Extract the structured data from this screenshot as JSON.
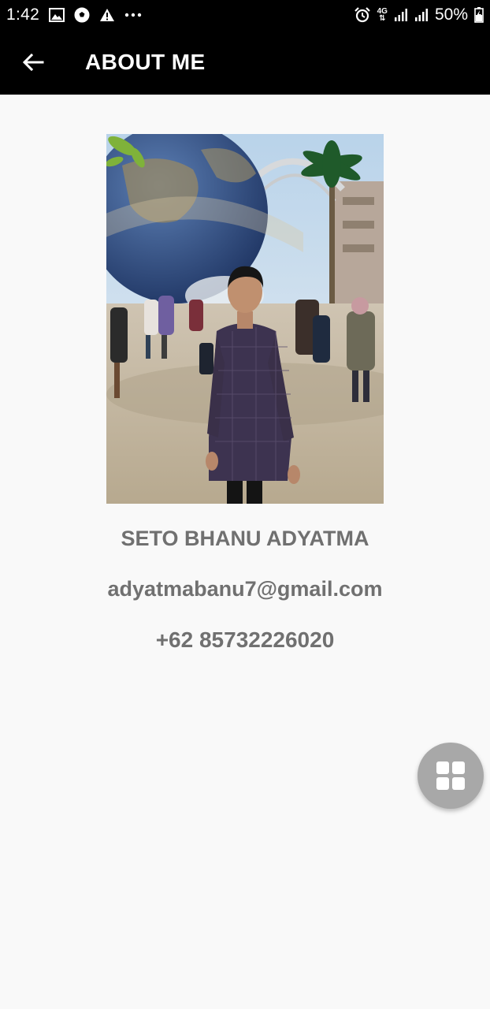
{
  "status_bar": {
    "time": "1:42",
    "network": "4G",
    "battery": "50%",
    "left_icons": [
      "image-icon",
      "soccer-ball-icon",
      "warning-icon",
      "more-dots-icon"
    ],
    "right_icons": [
      "alarm-icon",
      "signal-icon",
      "signal-icon",
      "battery-charging-icon"
    ]
  },
  "app_bar": {
    "title": "ABOUT ME",
    "back_icon": "arrow-left-icon"
  },
  "profile": {
    "photo_description_icon": "profile-photo",
    "name": "SETO BHANU ADYATMA",
    "email": "adyatmabanu7@gmail.com",
    "phone": "+62 85732226020"
  },
  "fab": {
    "icon": "grid-menu-icon"
  },
  "colors": {
    "bar_background": "#000000",
    "page_background": "#f9f9f9",
    "text_gray": "#707070",
    "fab_gray": "#a8a8a8"
  }
}
